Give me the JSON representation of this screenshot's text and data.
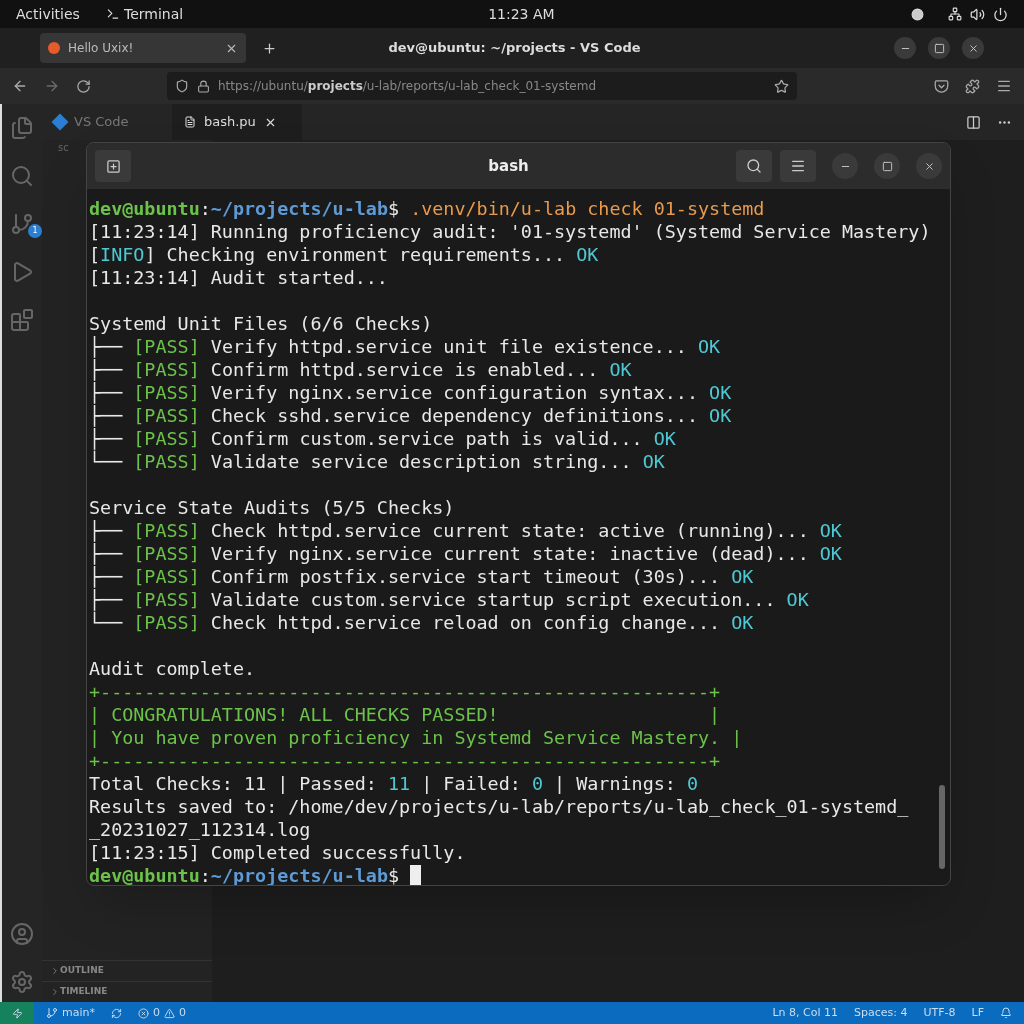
{
  "top_bar": {
    "activities": "Activities",
    "app": "Terminal",
    "clock": "11:23 AM"
  },
  "browser": {
    "tab": {
      "title": "Hello Uxix!"
    },
    "window_title": "dev@ubuntu: ~/projects - VS Code",
    "url": {
      "prefix": "https://ubuntu/",
      "bold": "projects",
      "rest": "/u-lab/reports/u-lab_check_01-systemd"
    }
  },
  "editor": {
    "tabs": [
      {
        "label": "VS Code",
        "selected": false
      },
      {
        "label": "bash.pu",
        "selected": true
      }
    ],
    "breadcrumb": "sc",
    "scm_badge": "1",
    "sidebar_sections": [
      "OUTLINE",
      "TIMELINE"
    ]
  },
  "terminal": {
    "title": "bash",
    "cursor_visible": true,
    "blocks": [
      {
        "lines": [
          [
            {
              "kind": "user",
              "text": "dev@ubuntu"
            },
            {
              "kind": "plain",
              "text": ":"
            },
            {
              "kind": "path",
              "text": "~/projects/u-lab"
            },
            {
              "kind": "plain",
              "text": "$ "
            },
            {
              "kind": "command",
              "text": ".venv/bin/u-lab check 01-systemd"
            }
          ],
          [
            {
              "kind": "plain",
              "text": "[11:23:14] Running proficiency audit: '01-systemd' (Systemd Service Mastery)"
            }
          ],
          [
            {
              "kind": "plain",
              "text": "["
            },
            {
              "kind": "info",
              "text": "INFO"
            },
            {
              "kind": "plain",
              "text": "] Checking environment requirements... "
            },
            {
              "kind": "ok",
              "text": "OK"
            }
          ],
          [
            {
              "kind": "plain",
              "text": "[11:23:14] Audit started..."
            }
          ]
        ]
      },
      {
        "lines": [
          [
            {
              "kind": "plain",
              "text": "Systemd Unit Files (6/6 Checks)"
            }
          ],
          [
            {
              "kind": "plain",
              "text": "├── "
            },
            {
              "kind": "pass",
              "text": "[PASS]"
            },
            {
              "kind": "plain",
              "text": " Verify httpd.service unit file existence... "
            },
            {
              "kind": "ok",
              "text": "OK"
            }
          ],
          [
            {
              "kind": "plain",
              "text": "├── "
            },
            {
              "kind": "pass",
              "text": "[PASS]"
            },
            {
              "kind": "plain",
              "text": " Confirm httpd.service is enabled... "
            },
            {
              "kind": "ok",
              "text": "OK"
            }
          ],
          [
            {
              "kind": "plain",
              "text": "├── "
            },
            {
              "kind": "pass",
              "text": "[PASS]"
            },
            {
              "kind": "plain",
              "text": " Verify nginx.service configuration syntax... "
            },
            {
              "kind": "ok",
              "text": "OK"
            }
          ],
          [
            {
              "kind": "plain",
              "text": "├── "
            },
            {
              "kind": "pass",
              "text": "[PASS]"
            },
            {
              "kind": "plain",
              "text": " Check sshd.service dependency definitions... "
            },
            {
              "kind": "ok",
              "text": "OK"
            }
          ],
          [
            {
              "kind": "plain",
              "text": "├── "
            },
            {
              "kind": "pass",
              "text": "[PASS]"
            },
            {
              "kind": "plain",
              "text": " Confirm custom.service path is valid... "
            },
            {
              "kind": "ok",
              "text": "OK"
            }
          ],
          [
            {
              "kind": "plain",
              "text": "└── "
            },
            {
              "kind": "pass",
              "text": "[PASS]"
            },
            {
              "kind": "plain",
              "text": " Validate service description string... "
            },
            {
              "kind": "ok",
              "text": "OK"
            }
          ]
        ]
      },
      {
        "lines": [
          [
            {
              "kind": "plain",
              "text": "Service State Audits (5/5 Checks)"
            }
          ],
          [
            {
              "kind": "plain",
              "text": "├── "
            },
            {
              "kind": "pass",
              "text": "[PASS]"
            },
            {
              "kind": "plain",
              "text": " Check httpd.service current state: active (running)... "
            },
            {
              "kind": "ok",
              "text": "OK"
            }
          ],
          [
            {
              "kind": "plain",
              "text": "├── "
            },
            {
              "kind": "pass",
              "text": "[PASS]"
            },
            {
              "kind": "plain",
              "text": " Verify nginx.service current state: inactive (dead)... "
            },
            {
              "kind": "ok",
              "text": "OK"
            }
          ],
          [
            {
              "kind": "plain",
              "text": "├── "
            },
            {
              "kind": "pass",
              "text": "[PASS]"
            },
            {
              "kind": "plain",
              "text": " Confirm postfix.service start timeout (30s)... "
            },
            {
              "kind": "ok",
              "text": "OK"
            }
          ],
          [
            {
              "kind": "plain",
              "text": "├── "
            },
            {
              "kind": "pass",
              "text": "[PASS]"
            },
            {
              "kind": "plain",
              "text": " Validate custom.service startup script execution... "
            },
            {
              "kind": "ok",
              "text": "OK"
            }
          ],
          [
            {
              "kind": "plain",
              "text": "└── "
            },
            {
              "kind": "pass",
              "text": "[PASS]"
            },
            {
              "kind": "plain",
              "text": " Check httpd.service reload on config change... "
            },
            {
              "kind": "ok",
              "text": "OK"
            }
          ]
        ]
      },
      {
        "lines": [
          [
            {
              "kind": "plain",
              "text": "Audit complete."
            }
          ],
          [
            {
              "kind": "banner",
              "text": "+-------------------------------------------------------+"
            }
          ],
          [
            {
              "kind": "banner",
              "text": "| CONGRATULATIONS! ALL CHECKS PASSED!                   |"
            }
          ],
          [
            {
              "kind": "banner",
              "text": "| You have proven proficiency in Systemd Service Mastery. |"
            }
          ],
          [
            {
              "kind": "banner",
              "text": "+-------------------------------------------------------+"
            }
          ],
          [
            {
              "kind": "plain",
              "text": "Total Checks: 11 | Passed: "
            },
            {
              "kind": "ok",
              "text": "11"
            },
            {
              "kind": "plain",
              "text": " | Failed: "
            },
            {
              "kind": "ok",
              "text": "0"
            },
            {
              "kind": "plain",
              "text": " | Warnings: "
            },
            {
              "kind": "ok",
              "text": "0"
            }
          ],
          [
            {
              "kind": "plain",
              "text": "Results saved to: /home/dev/projects/u-lab/reports/u-lab_check_01-systemd_"
            }
          ],
          [
            {
              "kind": "plain",
              "text": "_20231027_112314.log"
            }
          ],
          [
            {
              "kind": "plain",
              "text": "[11:23:15] Completed successfully."
            }
          ],
          [
            {
              "kind": "user",
              "text": "dev@ubuntu"
            },
            {
              "kind": "plain",
              "text": ":"
            },
            {
              "kind": "path",
              "text": "~/projects/u-lab"
            },
            {
              "kind": "plain",
              "text": "$ "
            }
          ]
        ]
      }
    ]
  },
  "status_bar": {
    "branch": "main*",
    "errors": "0",
    "warnings": "0",
    "right": [
      "Ln 8, Col 11",
      "Spaces: 4",
      "UTF-8",
      "LF"
    ]
  }
}
